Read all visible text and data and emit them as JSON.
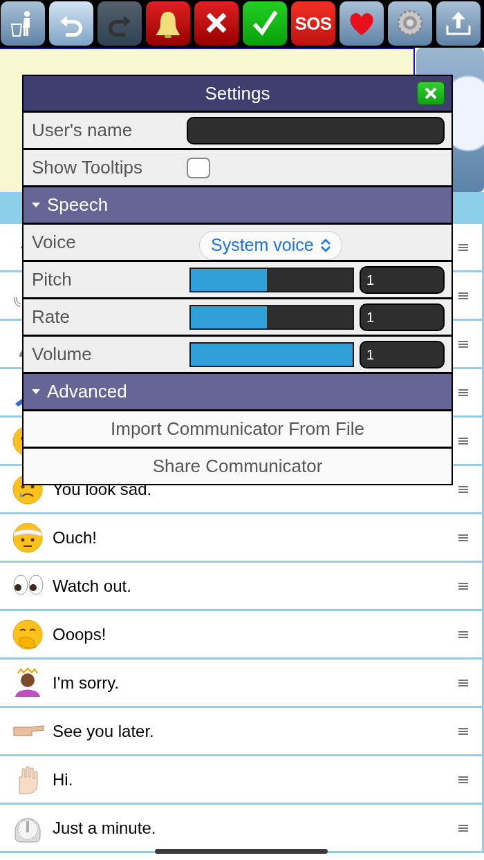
{
  "toolbar": [
    {
      "kind": "trash",
      "disabled": false
    },
    {
      "kind": "undo",
      "disabled": false
    },
    {
      "kind": "redo",
      "disabled": true
    },
    {
      "kind": "bell",
      "disabled": false
    },
    {
      "kind": "cancel",
      "disabled": false
    },
    {
      "kind": "confirm",
      "disabled": false
    },
    {
      "kind": "sos",
      "label": "SOS",
      "disabled": false
    },
    {
      "kind": "heart",
      "disabled": false
    },
    {
      "kind": "settings",
      "disabled": false
    },
    {
      "kind": "share",
      "disabled": false
    }
  ],
  "phrases": [
    {
      "kind": "covered"
    },
    {
      "kind": "covered"
    },
    {
      "kind": "covered"
    },
    {
      "kind": "covered"
    },
    {
      "kind": "covered"
    },
    {
      "kind": "phrase",
      "text": "You look sad."
    },
    {
      "kind": "phrase",
      "text": "Ouch!"
    },
    {
      "kind": "phrase",
      "text": "Watch out."
    },
    {
      "kind": "phrase",
      "text": "Ooops!"
    },
    {
      "kind": "phrase",
      "text": "I'm sorry."
    },
    {
      "kind": "phrase",
      "text": "See you later."
    },
    {
      "kind": "phrase",
      "text": "Hi."
    },
    {
      "kind": "phrase",
      "text": "Just a minute."
    }
  ],
  "settings": {
    "title": "Settings",
    "rows": [
      {
        "kind": "text",
        "label": "User's name"
      },
      {
        "kind": "checkbox",
        "label": "Show Tooltips",
        "checked": false
      },
      {
        "kind": "section",
        "label": "Speech",
        "expanded": true
      },
      {
        "kind": "select",
        "label": "Voice",
        "value": "System voice"
      },
      {
        "kind": "slider",
        "label": "Pitch",
        "level": 0.47,
        "value": "1"
      },
      {
        "kind": "slider",
        "label": "Rate",
        "level": 0.47,
        "value": "1"
      },
      {
        "kind": "slider",
        "label": "Volume",
        "level": 1.0,
        "value": "1"
      },
      {
        "kind": "section",
        "label": "Advanced",
        "expanded": true
      },
      {
        "kind": "action",
        "label": "Import Communicator From File"
      },
      {
        "kind": "action",
        "label": "Share Communicator"
      }
    ]
  }
}
